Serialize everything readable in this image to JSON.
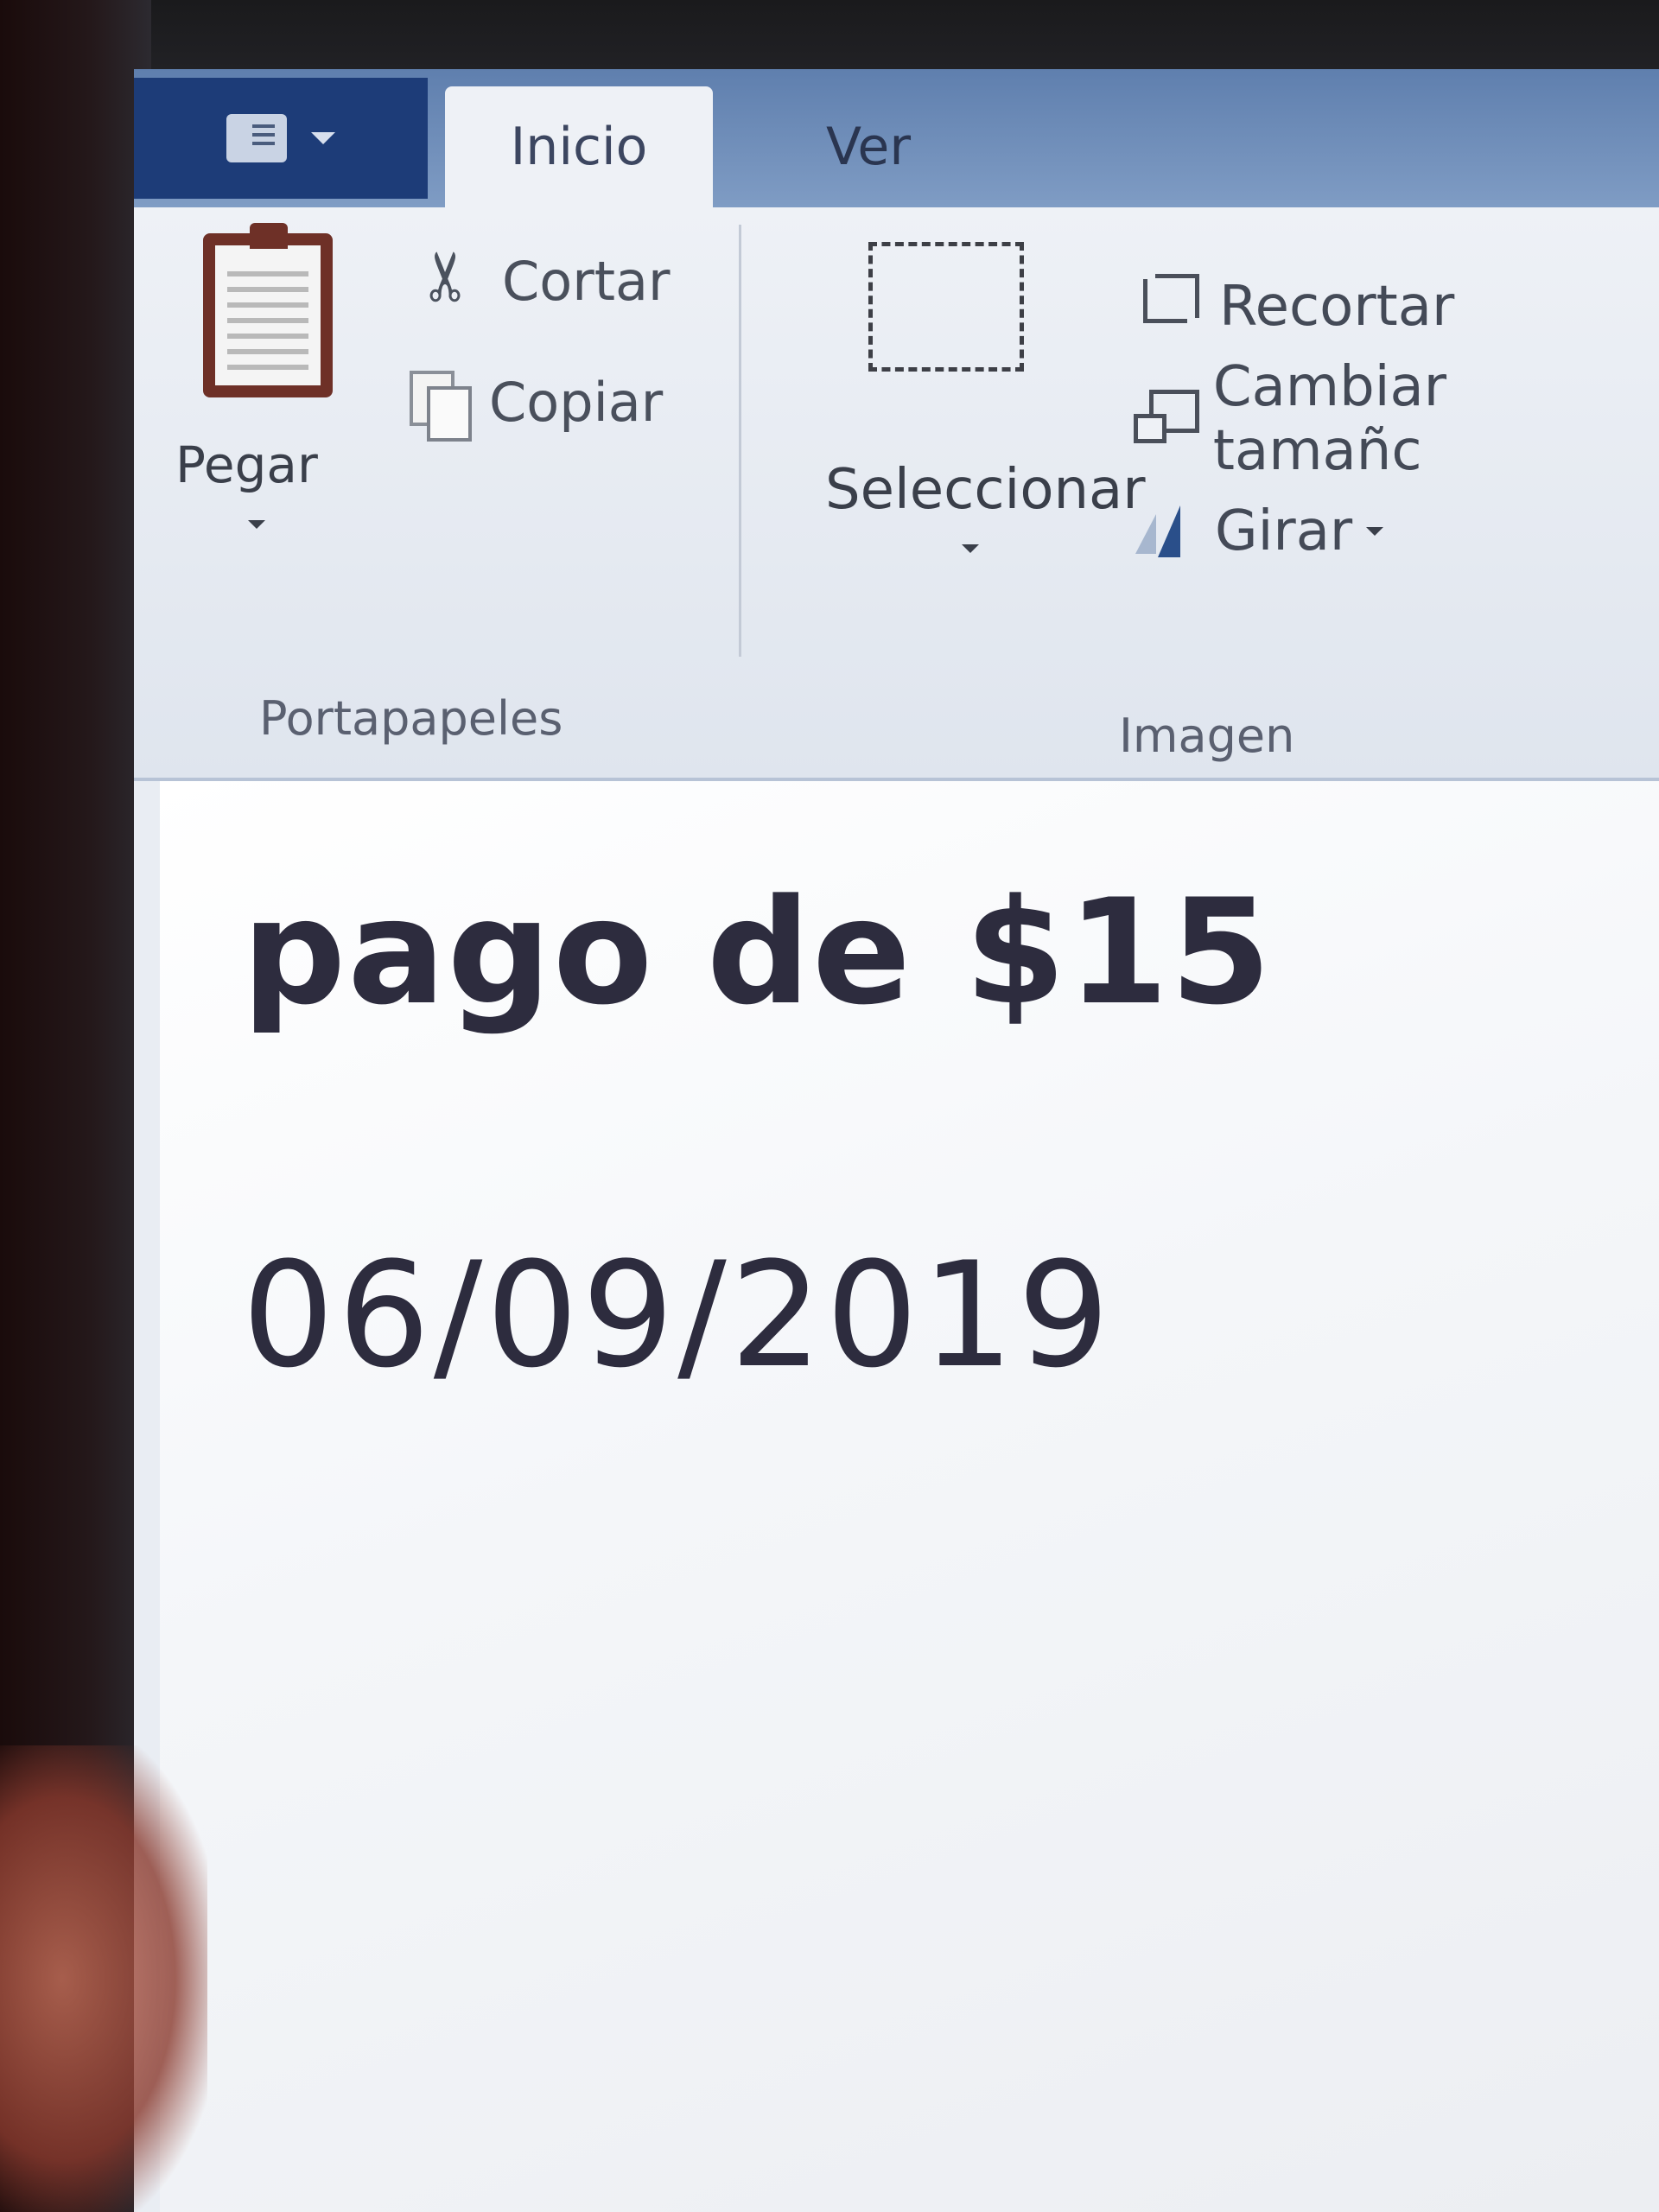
{
  "tabs": {
    "file_menu": "file-menu",
    "inicio": "Inicio",
    "ver": "Ver"
  },
  "ribbon": {
    "portapapeles": {
      "group_label": "Portapapeles",
      "pegar": "Pegar",
      "cortar": "Cortar",
      "copiar": "Copiar"
    },
    "imagen": {
      "group_label": "Imagen",
      "seleccionar": "Seleccionar",
      "recortar": "Recortar",
      "cambiar_tamano": "Cambiar tamañc",
      "girar": "Girar"
    }
  },
  "canvas": {
    "line1": "pago de $15",
    "line2": "06/09/2019"
  },
  "icons": {
    "paste": "clipboard-icon",
    "cut": "scissors-icon",
    "copy": "copy-icon",
    "select": "select-rectangle-icon",
    "crop": "crop-icon",
    "resize": "resize-icon",
    "rotate": "rotate-icon"
  }
}
